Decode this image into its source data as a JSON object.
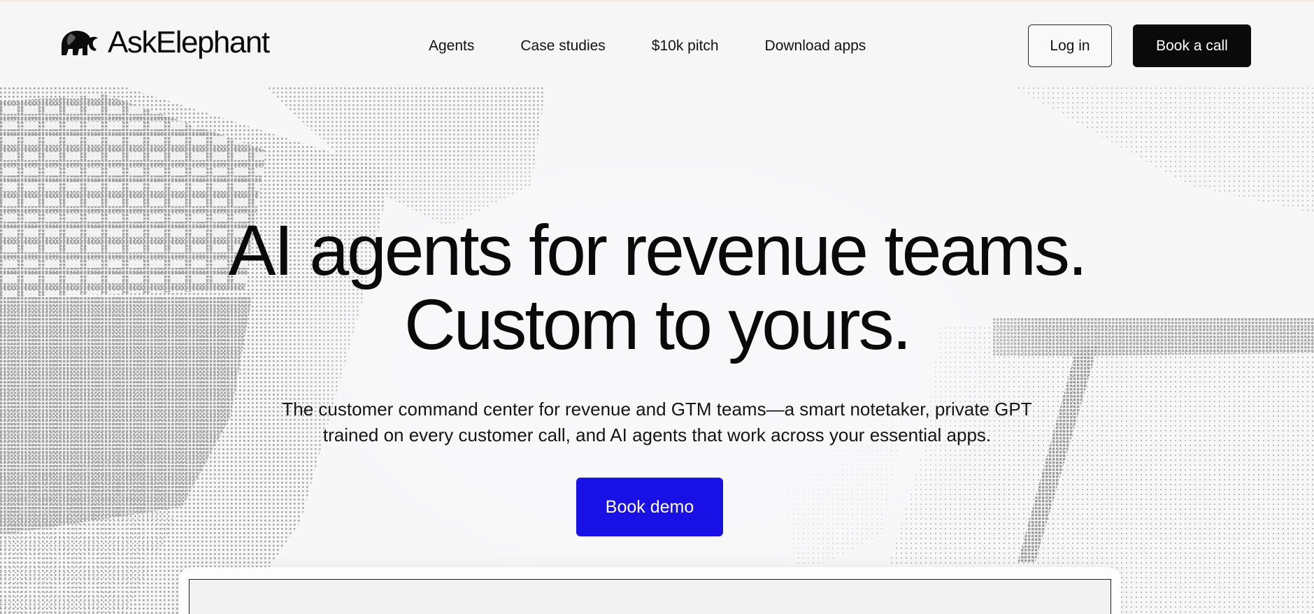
{
  "brand": {
    "name": "AskElephant",
    "logo_icon": "elephant-icon"
  },
  "nav": {
    "items": [
      {
        "label": "Agents"
      },
      {
        "label": "Case studies"
      },
      {
        "label": "$10k pitch"
      },
      {
        "label": "Download apps"
      }
    ],
    "login_label": "Log in",
    "book_call_label": "Book a call"
  },
  "hero": {
    "title_line1": "AI agents for revenue teams.",
    "title_line2": "Custom to yours.",
    "subtitle_line1": "The customer command center for revenue and GTM teams—a smart notetaker, private GPT",
    "subtitle_line2": "trained on every customer call, and AI agents that work across your essential apps.",
    "cta_label": "Book demo"
  },
  "colors": {
    "primary_cta": "#1810e4",
    "dark_button": "#0a0a0a",
    "halftone": "#a9a9a9"
  }
}
